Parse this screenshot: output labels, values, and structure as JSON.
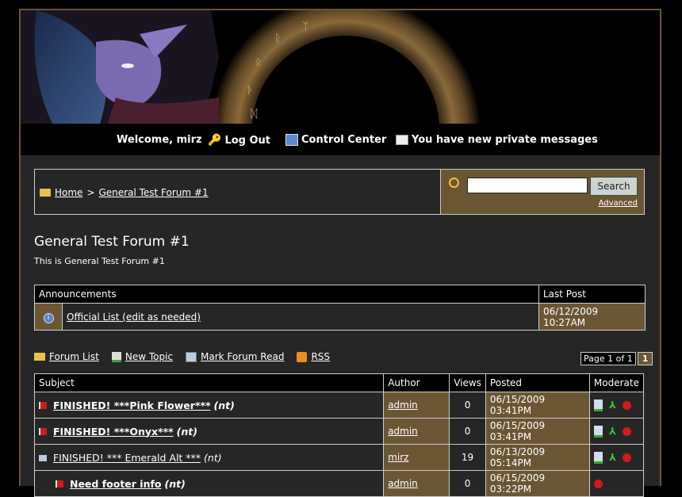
{
  "nav": {
    "welcome": "Welcome, mirz",
    "logout": "Log Out",
    "control_center": "Control Center",
    "private_messages": "You have new private messages"
  },
  "breadcrumb": {
    "home": "Home",
    "separator": ">",
    "forum": "General Test Forum #1"
  },
  "search": {
    "button": "Search",
    "advanced": "Advanced",
    "value": ""
  },
  "forum": {
    "title": "General Test Forum #1",
    "description": "This is General Test Forum #1"
  },
  "announcements": {
    "header_title": "Announcements",
    "header_last_post": "Last Post",
    "rows": [
      {
        "title": "Official List (edit as needed)",
        "last_post": "06/12/2009 10:27AM"
      }
    ]
  },
  "tools": {
    "forum_list": "Forum List",
    "new_topic": "New Topic",
    "mark_read": "Mark Forum Read",
    "rss": "RSS"
  },
  "pager": {
    "label": "Page 1 of 1",
    "current": "1"
  },
  "threads": {
    "headers": {
      "subject": "Subject",
      "author": "Author",
      "views": "Views",
      "posted": "Posted",
      "moderate": "Moderate"
    },
    "rows": [
      {
        "subject": "FINISHED! ***Pink Flower***",
        "suffix": "(nt)",
        "author": "admin",
        "views": "0",
        "posted": "06/15/2009 03:41PM"
      },
      {
        "subject": "FINISHED! ***Onyx***",
        "suffix": "(nt)",
        "author": "admin",
        "views": "0",
        "posted": "06/15/2009 03:41PM"
      },
      {
        "subject": "FINISHED! *** Emerald Alt ***",
        "suffix": "(nt)",
        "author": "mirz",
        "views": "19",
        "posted": "06/13/2009 05:14PM"
      },
      {
        "subject": "Need footer info",
        "suffix": "(nt)",
        "author": "admin",
        "views": "0",
        "posted": "06/15/2009 03:22PM"
      }
    ]
  },
  "colors": {
    "accent_brown": "#6b5634",
    "panel": "#262626",
    "flag_red": "#d11a1a"
  }
}
